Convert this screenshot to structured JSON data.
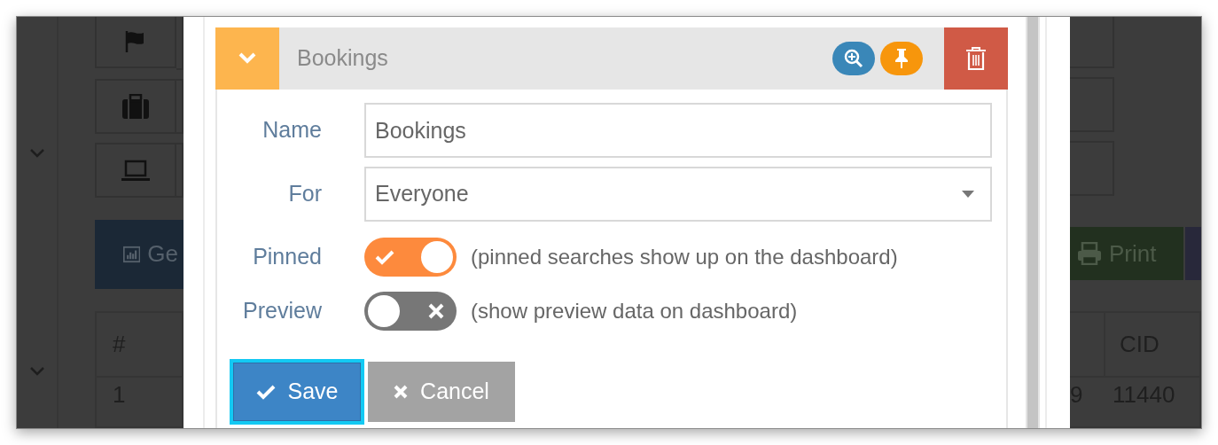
{
  "background_left": {
    "button_label": "Ge",
    "table_header": "#",
    "table_cell": "1"
  },
  "search_panel": {
    "title": "Bookings",
    "expanded": true,
    "fields": [
      {
        "label": "Name",
        "kind": "text",
        "value": "Bookings"
      },
      {
        "label": "For",
        "kind": "select",
        "value": "Everyone"
      }
    ],
    "toggles": [
      {
        "label": "Pinned",
        "on": true,
        "hint": "(pinned searches show up on the dashboard)"
      },
      {
        "label": "Preview",
        "on": false,
        "hint": "(show preview data on dashboard)"
      }
    ],
    "buttons": [
      {
        "label": "Save",
        "kind": "primary",
        "focused": true
      },
      {
        "label": "Cancel",
        "kind": "secondary",
        "focused": false
      }
    ]
  },
  "background_right": {
    "button_label": "Print",
    "table_header": "CID",
    "table_cells": [
      "9",
      "11440"
    ]
  }
}
